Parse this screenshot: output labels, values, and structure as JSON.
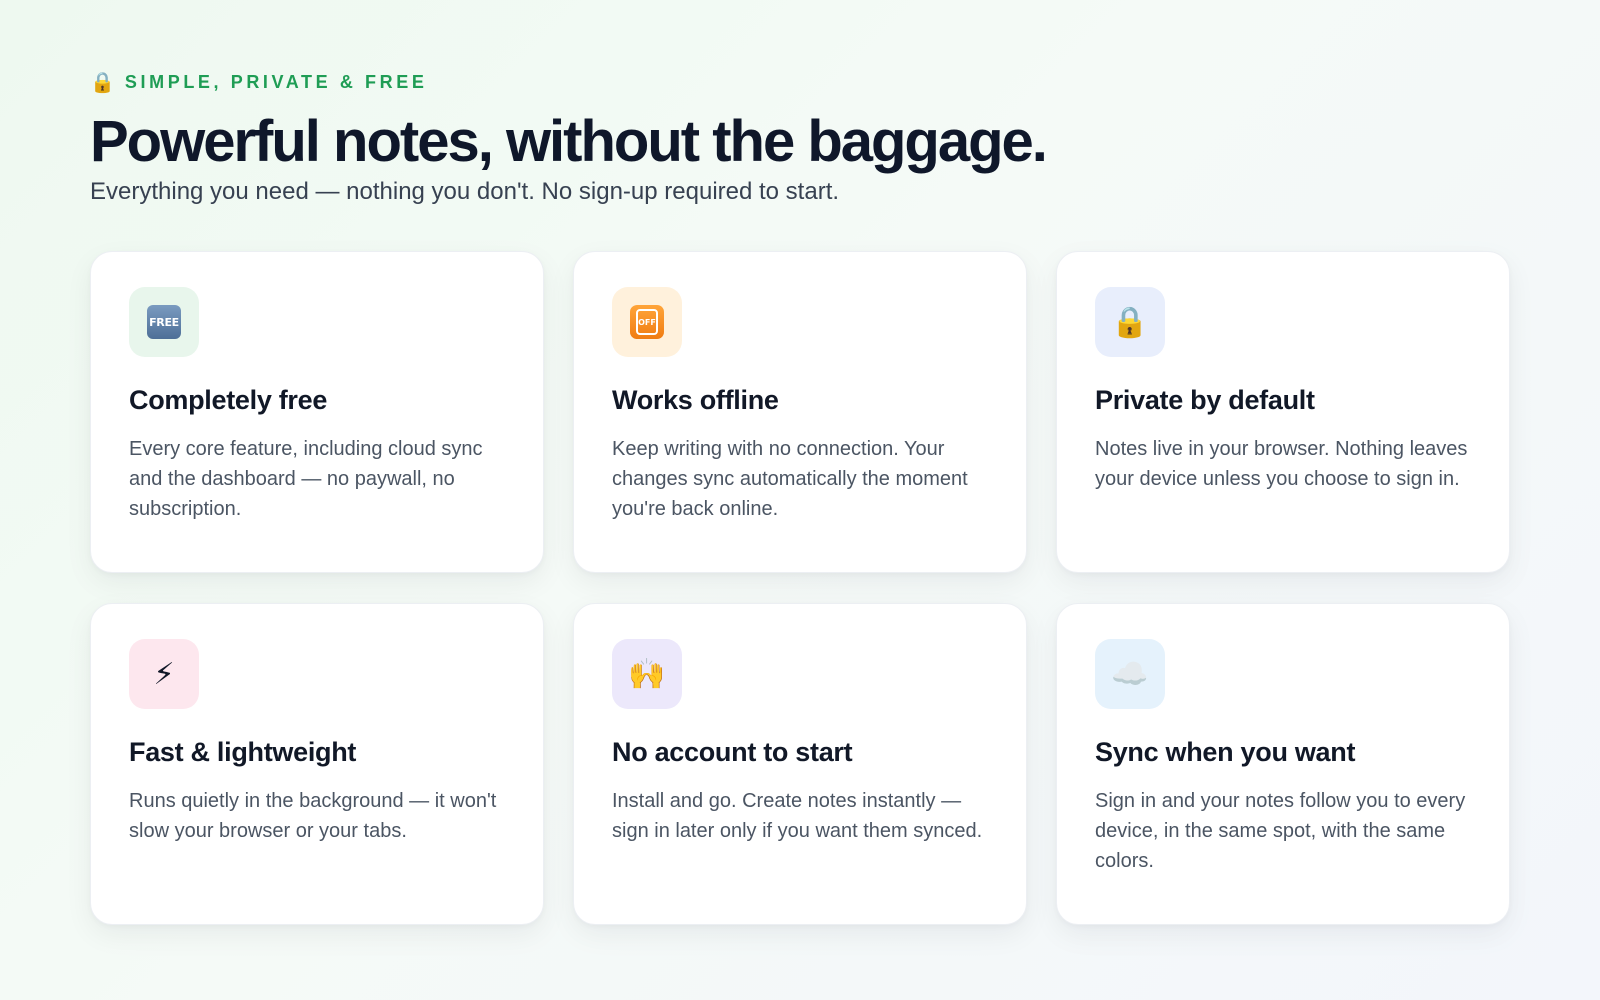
{
  "eyebrow": {
    "icon": "lock-icon",
    "icon_glyph": "🔒",
    "label": "SIMPLE, PRIVATE & FREE"
  },
  "headline": "Powerful notes, without the baggage.",
  "subhead": "Everything you need — nothing you don't. No sign-up required to start.",
  "features": [
    {
      "icon": "free-badge-icon",
      "icon_text": "FREE",
      "tile_color": "#e8f6ec",
      "title": "Completely free",
      "body": "Every core feature, including cloud sync and the dashboard — no paywall, no subscription."
    },
    {
      "icon": "offline-phone-icon",
      "icon_text": "OFF",
      "tile_color": "#fff1dc",
      "title": "Works offline",
      "body": "Keep writing with no connection. Your changes sync automatically the moment you're back online."
    },
    {
      "icon": "lock-icon",
      "icon_glyph": "🔒",
      "tile_color": "#e8eefc",
      "title": "Private by default",
      "body": "Notes live in your browser. Nothing leaves your device unless you choose to sign in."
    },
    {
      "icon": "lightning-icon",
      "icon_glyph": "⚡",
      "tile_color": "#fde7ee",
      "title": "Fast & lightweight",
      "body": "Runs quietly in the background — it won't slow your browser or your tabs."
    },
    {
      "icon": "raised-hands-icon",
      "icon_glyph": "🙌",
      "tile_color": "#ece8fb",
      "title": "No account to start",
      "body": "Install and go. Create notes instantly — sign in later only if you want them synced."
    },
    {
      "icon": "cloud-icon",
      "icon_glyph": "☁️",
      "tile_color": "#e5f2fc",
      "title": "Sync when you want",
      "body": "Sign in and your notes follow you to every device, in the same spot, with the same colors."
    }
  ],
  "colors": {
    "accent_green": "#1f9d55",
    "headline": "#0f172a",
    "body_text": "#4b5563"
  }
}
